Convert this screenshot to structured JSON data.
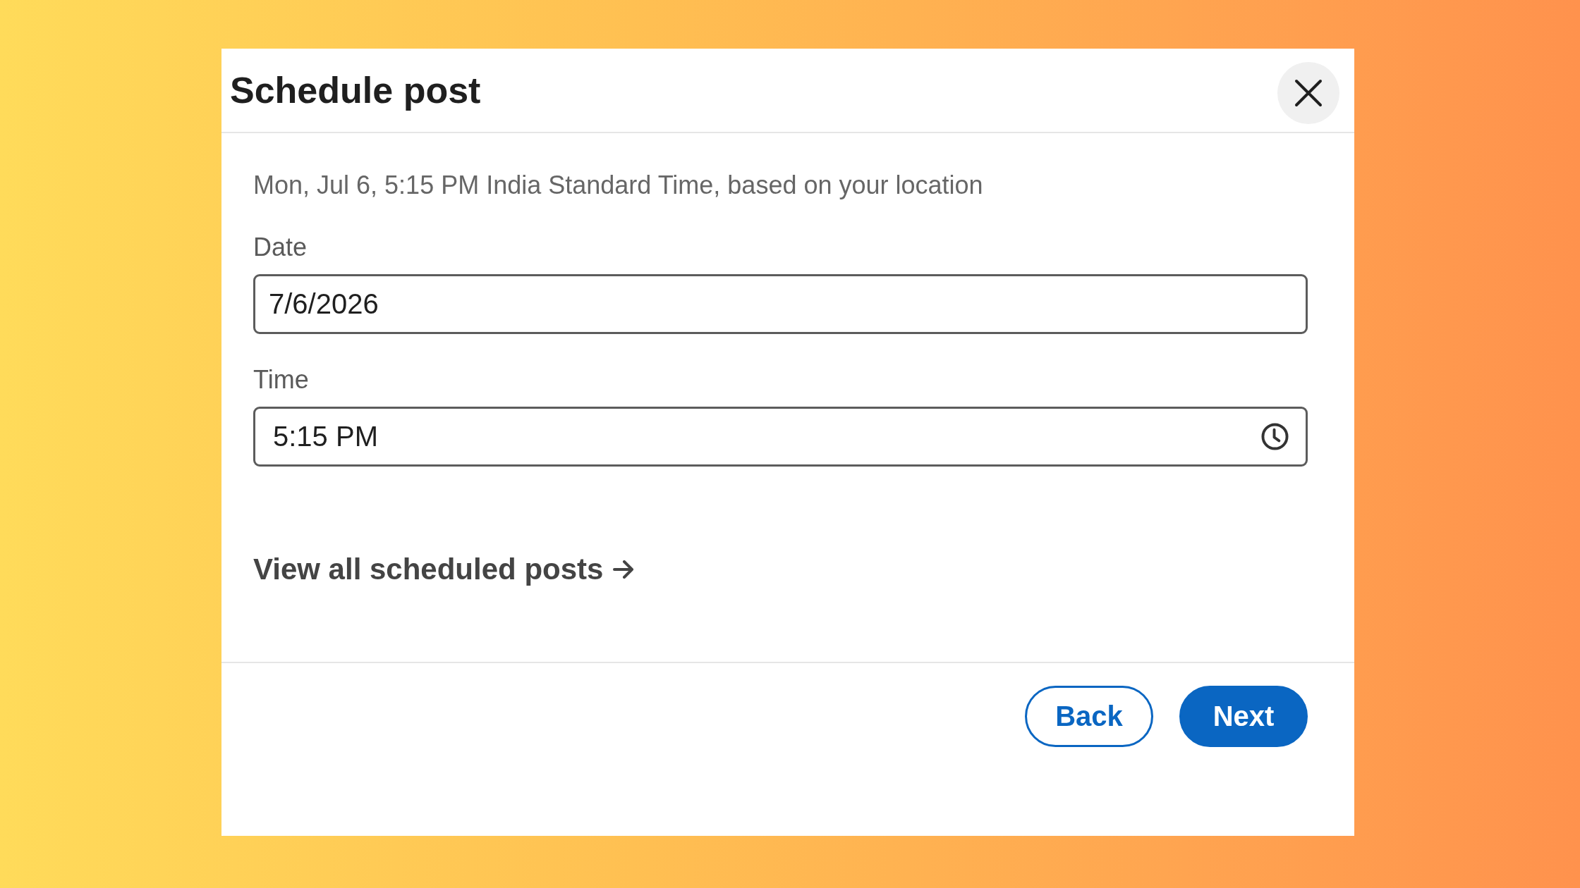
{
  "dialog": {
    "title": "Schedule post"
  },
  "timezone_note": "Mon, Jul 6, 5:15 PM India Standard Time, based on your location",
  "fields": [
    {
      "kind": "date",
      "label": "Date",
      "value": "7/6/2026"
    },
    {
      "kind": "time",
      "label": "Time",
      "value": "5:15 PM"
    }
  ],
  "link": {
    "label": "View all scheduled posts"
  },
  "buttons": [
    {
      "kind": "secondary",
      "label": "Back"
    },
    {
      "kind": "primary",
      "label": "Next"
    }
  ]
}
